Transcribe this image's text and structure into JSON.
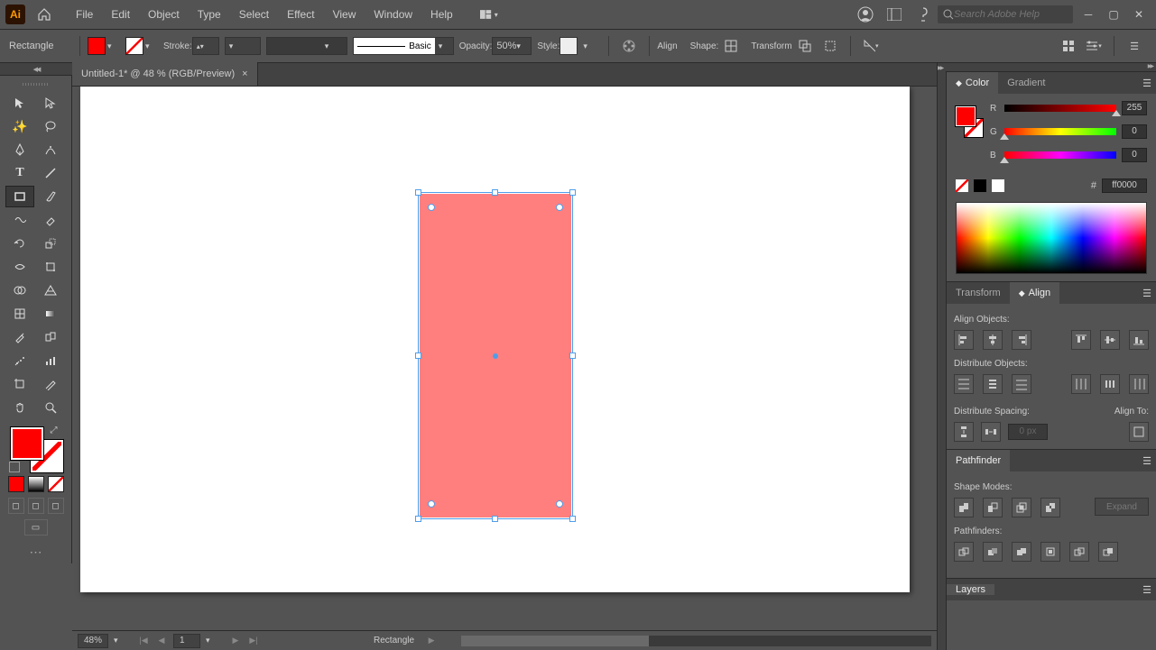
{
  "app": {
    "logo": "Ai"
  },
  "menu": [
    "File",
    "Edit",
    "Object",
    "Type",
    "Select",
    "Effect",
    "View",
    "Window",
    "Help"
  ],
  "search": {
    "placeholder": "Search Adobe Help"
  },
  "control": {
    "tool_name": "Rectangle",
    "stroke_label": "Stroke:",
    "stroke_weight": "",
    "brush_label": "Basic",
    "opacity_label": "Opacity:",
    "opacity_value": "50%",
    "style_label": "Style:",
    "align_label": "Align",
    "shape_label": "Shape:",
    "transform_label": "Transform"
  },
  "document": {
    "tab_title": "Untitled-1* @ 48 % (RGB/Preview)"
  },
  "status": {
    "zoom": "48%",
    "artboard_num": "1",
    "selection": "Rectangle"
  },
  "panels": {
    "color": {
      "tab1": "Color",
      "tab2": "Gradient",
      "r_label": "R",
      "g_label": "G",
      "b_label": "B",
      "r_val": "255",
      "g_val": "0",
      "b_val": "0",
      "hex_prefix": "#",
      "hex_val": "ff0000"
    },
    "align": {
      "tab1": "Transform",
      "tab2": "Align",
      "section1": "Align Objects:",
      "section2": "Distribute Objects:",
      "section3": "Distribute Spacing:",
      "alignto_label": "Align To:",
      "spacing_val": "0 px"
    },
    "pathfinder": {
      "tab": "Pathfinder",
      "section1": "Shape Modes:",
      "section2": "Pathfinders:",
      "expand": "Expand"
    },
    "layers": {
      "tab": "Layers"
    }
  },
  "shape": {
    "fill": "#ff0000",
    "opacity": 0.5
  }
}
